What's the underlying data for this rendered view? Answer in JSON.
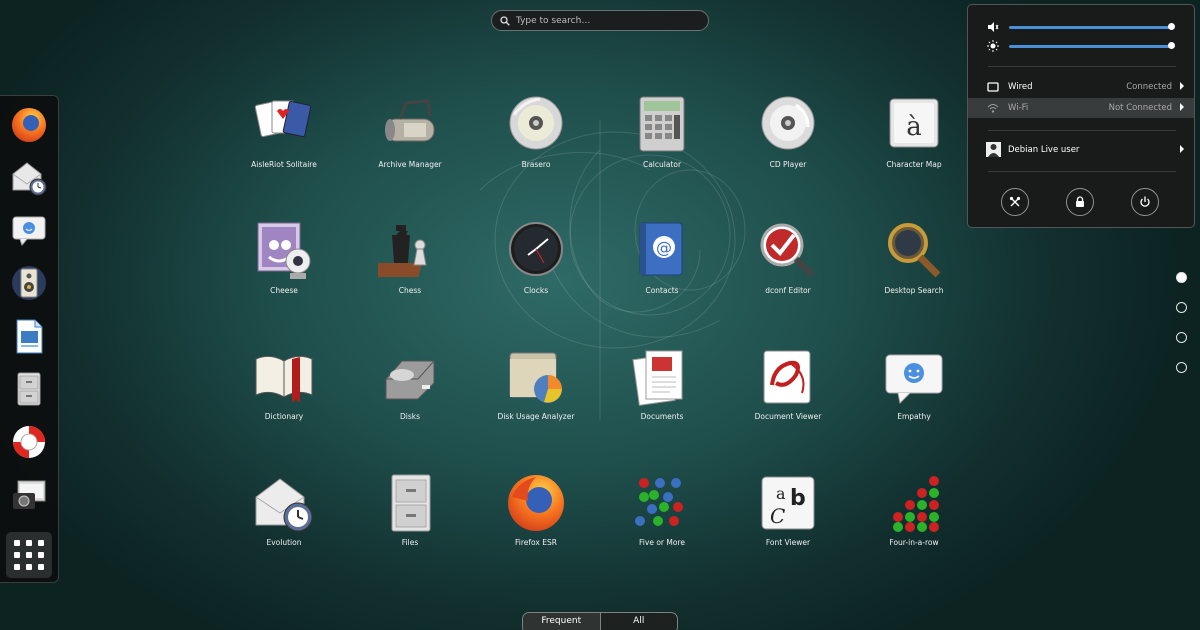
{
  "search": {
    "placeholder": "Type to search…"
  },
  "dash": {
    "items": [
      {
        "name": "firefox-icon"
      },
      {
        "name": "evolution-icon"
      },
      {
        "name": "empathy-icon"
      },
      {
        "name": "rhythmbox-icon"
      },
      {
        "name": "libreoffice-writer-icon"
      },
      {
        "name": "files-icon"
      },
      {
        "name": "help-icon"
      },
      {
        "name": "screenshot-icon"
      }
    ],
    "show_apps": "show-applications-icon"
  },
  "apps": [
    {
      "label": "AisleRiot Solitaire",
      "icon": "aisleriot-icon"
    },
    {
      "label": "Archive Manager",
      "icon": "archive-manager-icon"
    },
    {
      "label": "Brasero",
      "icon": "brasero-icon"
    },
    {
      "label": "Calculator",
      "icon": "calculator-icon"
    },
    {
      "label": "CD Player",
      "icon": "cd-player-icon"
    },
    {
      "label": "Character Map",
      "icon": "character-map-icon"
    },
    {
      "label": "Cheese",
      "icon": "cheese-icon"
    },
    {
      "label": "Chess",
      "icon": "chess-icon"
    },
    {
      "label": "Clocks",
      "icon": "clocks-icon"
    },
    {
      "label": "Contacts",
      "icon": "contacts-icon"
    },
    {
      "label": "dconf Editor",
      "icon": "dconf-editor-icon"
    },
    {
      "label": "Desktop Search",
      "icon": "desktop-search-icon"
    },
    {
      "label": "Dictionary",
      "icon": "dictionary-icon"
    },
    {
      "label": "Disks",
      "icon": "disks-icon"
    },
    {
      "label": "Disk Usage Analyzer",
      "icon": "disk-usage-analyzer-icon"
    },
    {
      "label": "Documents",
      "icon": "documents-icon"
    },
    {
      "label": "Document Viewer",
      "icon": "document-viewer-icon"
    },
    {
      "label": "Empathy",
      "icon": "empathy-icon"
    },
    {
      "label": "Evolution",
      "icon": "evolution-icon"
    },
    {
      "label": "Files",
      "icon": "files-icon"
    },
    {
      "label": "Firefox ESR",
      "icon": "firefox-icon"
    },
    {
      "label": "Five or More",
      "icon": "five-or-more-icon"
    },
    {
      "label": "Font Viewer",
      "icon": "font-viewer-icon"
    },
    {
      "label": "Four-in-a-row",
      "icon": "four-in-a-row-icon"
    }
  ],
  "pages": {
    "count": 4,
    "current": 1
  },
  "view_switch": {
    "frequent": "Frequent",
    "all": "All",
    "selected": "All"
  },
  "status_menu": {
    "volume_level": 1.0,
    "brightness_level": 1.0,
    "wired": {
      "label": "Wired",
      "state": "Connected"
    },
    "wifi": {
      "label": "Wi-Fi",
      "state": "Not Connected"
    },
    "user": {
      "label": "Debian Live user"
    },
    "buttons": [
      "settings-icon",
      "lock-icon",
      "power-icon"
    ]
  },
  "colors": {
    "accent": "#4a90d9",
    "menu_bg": "#191b1b",
    "highlight_row": "#393c3c"
  }
}
